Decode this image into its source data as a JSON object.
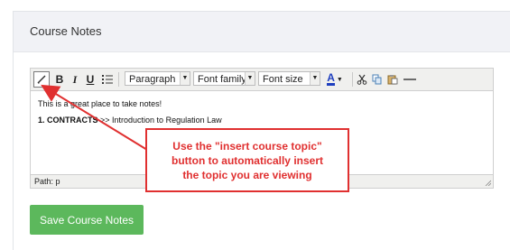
{
  "panel": {
    "title": "Course Notes"
  },
  "toolbar": {
    "insert_topic_icon": "pencil-icon",
    "bold_label": "B",
    "italic_label": "I",
    "underline_label": "U",
    "list_icon": "list-icon",
    "paragraph_label": "Paragraph",
    "font_family_label": "Font family",
    "font_size_label": "Font size",
    "font_color_label": "A",
    "cut_icon": "scissors-icon",
    "copy_icon": "copy-icon",
    "paste_icon": "paste-icon",
    "hr_icon": "horizontal-rule-icon"
  },
  "editor": {
    "line1": "This is a great place to take notes!",
    "line2_prefix": "1. CONTRACTS",
    "line2_suffix": " >> Introduction to Regulation Law",
    "path_label": "Path: p"
  },
  "save_button": {
    "label": "Save Course Notes"
  },
  "annotation": {
    "line1": "Use the \"insert course topic\"",
    "line2": "button to automatically insert",
    "line3": "the topic you are viewing"
  },
  "colors": {
    "accent_green": "#5cb85c",
    "annotation_red": "#e03030"
  }
}
